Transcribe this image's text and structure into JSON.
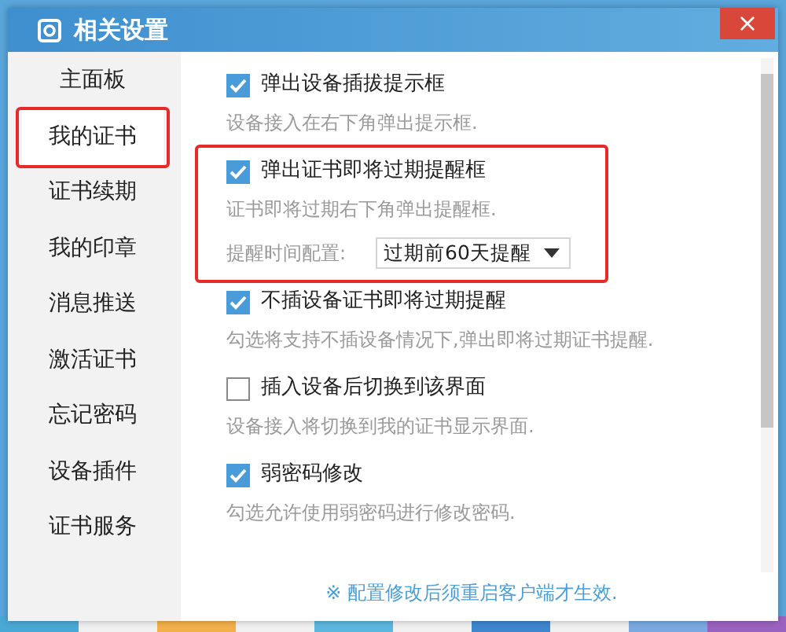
{
  "window": {
    "title": "相关设置",
    "close": "×"
  },
  "sidebar": {
    "items": [
      {
        "label": "主面板",
        "selected": false,
        "annotated": false
      },
      {
        "label": "我的证书",
        "selected": true,
        "annotated": true
      },
      {
        "label": "证书续期",
        "selected": false,
        "annotated": false
      },
      {
        "label": "我的印章",
        "selected": false,
        "annotated": false
      },
      {
        "label": "消息推送",
        "selected": false,
        "annotated": false
      },
      {
        "label": "激活证书",
        "selected": false,
        "annotated": false
      },
      {
        "label": "忘记密码",
        "selected": false,
        "annotated": false
      },
      {
        "label": "设备插件",
        "selected": false,
        "annotated": false
      },
      {
        "label": "证书服务",
        "selected": false,
        "annotated": false
      }
    ]
  },
  "settings": [
    {
      "label": "弹出设备插拔提示框",
      "checked": true,
      "description": "设备接入在右下角弹出提示框.",
      "annotated": false
    },
    {
      "label": "弹出证书即将过期提醒框",
      "checked": true,
      "description": "证书即将过期右下角弹出提醒框.",
      "annotated": true,
      "option": {
        "label": "提醒时间配置:",
        "value": "过期前60天提醒"
      }
    },
    {
      "label": "不插设备证书即将过期提醒",
      "checked": true,
      "description": "勾选将支持不插设备情况下,弹出即将过期证书提醒.",
      "annotated": false
    },
    {
      "label": "插入设备后切换到该界面",
      "checked": false,
      "description": "设备接入将切换到我的证书显示界面.",
      "annotated": false
    },
    {
      "label": "弱密码修改",
      "checked": true,
      "description": "勾选允许使用弱密码进行修改密码.",
      "annotated": false
    }
  ],
  "footnote": "※ 配置修改后须重启客户端才生效."
}
